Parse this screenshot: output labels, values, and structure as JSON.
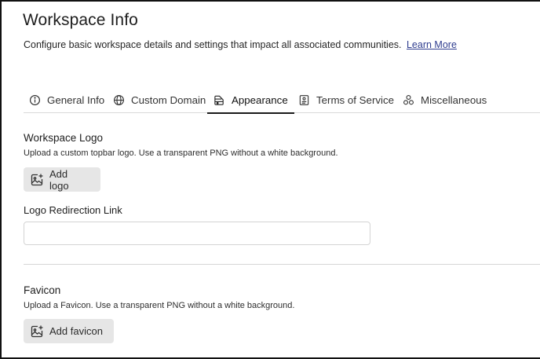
{
  "header": {
    "title": "Workspace Info",
    "description": "Configure basic workspace details and settings that impact all associated communities.",
    "learn_more": "Learn More"
  },
  "tabs": [
    {
      "label": "General Info",
      "icon": "info-circle-icon",
      "active": false
    },
    {
      "label": "Custom Domain",
      "icon": "globe-icon",
      "active": false
    },
    {
      "label": "Appearance",
      "icon": "palette-icon",
      "active": true
    },
    {
      "label": "Terms of Service",
      "icon": "document-icon",
      "active": false
    },
    {
      "label": "Miscellaneous",
      "icon": "circles-icon",
      "active": false
    }
  ],
  "logo_section": {
    "title": "Workspace Logo",
    "subtitle": "Upload a custom topbar logo. Use a transparent PNG without a white background.",
    "button_label": "Add logo"
  },
  "redirect_link": {
    "label": "Logo Redirection Link",
    "value": "",
    "placeholder": ""
  },
  "favicon_section": {
    "title": "Favicon",
    "subtitle": "Upload a Favicon. Use a transparent PNG without a white background.",
    "button_label": "Add favicon"
  },
  "colors": {
    "link": "#2f3d8f",
    "button_bg": "#e6e6e6",
    "active_tab_underline": "#1a1a1a"
  }
}
